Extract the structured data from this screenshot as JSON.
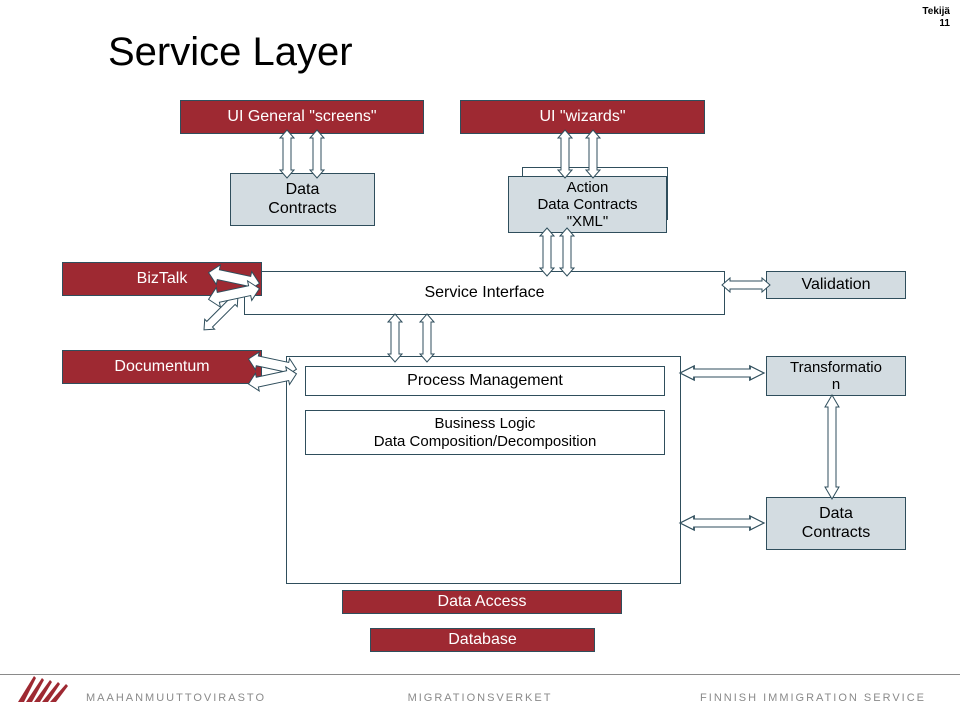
{
  "meta": {
    "author_label": "Tekijä",
    "slide_number": "11"
  },
  "title": "Service Layer",
  "boxes": {
    "ui_general": "UI General \"screens\"",
    "ui_wizards": "UI \"wizards\"",
    "data_contracts_top": "Data\nContracts",
    "action": "Action\nData Contracts\n\"XML\"",
    "biztalk": "BizTalk",
    "service_interface": "Service Interface",
    "validation": "Validation",
    "documentum": "Documentum",
    "process_mgmt": "Process Management",
    "transformation": "Transformatio\nn",
    "business_logic": "Business Logic\nData Composition/Decomposition",
    "data_contracts_right": "Data\nContracts",
    "data_access": "Data Access",
    "database": "Database"
  },
  "footer": {
    "left": "MAAHANMUUTTOVIRASTO",
    "mid": "MIGRATIONSVERKET",
    "right": "FINNISH IMMIGRATION SERVICE"
  },
  "colors": {
    "maroon": "#9E2932",
    "paleblue": "#D3DCE1",
    "border": "#2F4E5C"
  }
}
